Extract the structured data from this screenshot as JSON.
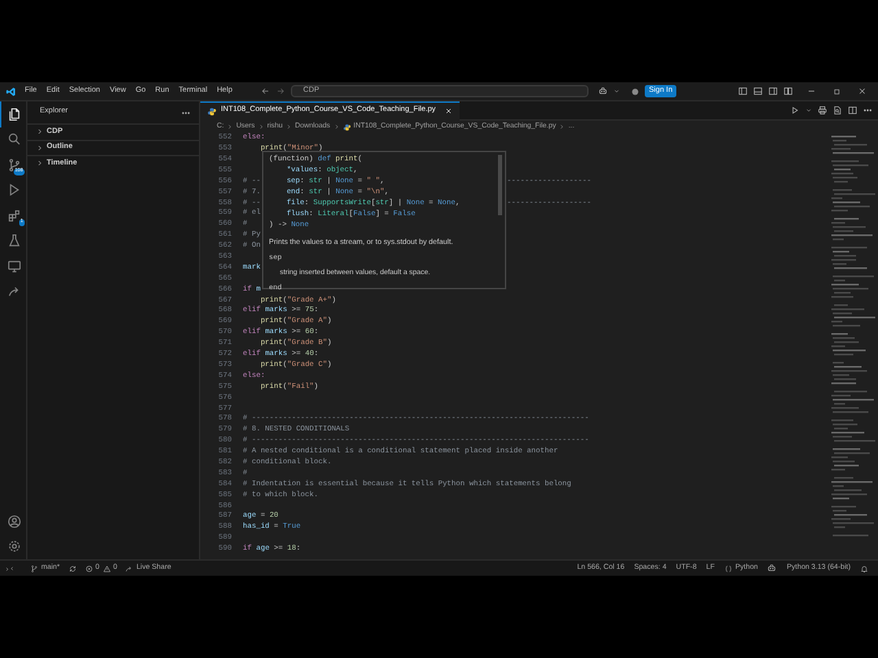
{
  "title_bar": {
    "menus": [
      "File",
      "Edit",
      "Selection",
      "View",
      "Go",
      "Run",
      "Terminal",
      "Help"
    ],
    "command_center": "CDP",
    "sign_in": "Sign In"
  },
  "activity_bar": {
    "items": [
      {
        "kind": "explorer",
        "selected": true
      },
      {
        "kind": "search",
        "selected": false
      },
      {
        "kind": "source-control",
        "selected": false,
        "badge": "108"
      },
      {
        "kind": "debug",
        "selected": false
      },
      {
        "kind": "extensions",
        "selected": false,
        "badge": "1"
      },
      {
        "kind": "testing",
        "selected": false
      },
      {
        "kind": "remote",
        "selected": false
      },
      {
        "kind": "liveshare",
        "selected": false
      }
    ]
  },
  "sidebar": {
    "title": "Explorer",
    "sections": [
      {
        "label": "CDP",
        "expanded": false
      },
      {
        "label": "Outline",
        "expanded": false
      },
      {
        "label": "Timeline",
        "expanded": false
      }
    ]
  },
  "tabs": [
    {
      "label": "INT108_Complete_Python_Course_VS_Code_Teaching_File.py",
      "selected": true
    }
  ],
  "breadcrumb": [
    {
      "kind": "folder",
      "text": "C:"
    },
    {
      "kind": "folder",
      "text": "Users"
    },
    {
      "kind": "folder",
      "text": "rishu"
    },
    {
      "kind": "folder",
      "text": "Downloads"
    },
    {
      "kind": "python",
      "text": "INT108_Complete_Python_Course_VS_Code_Teaching_File.py"
    },
    {
      "kind": "folder",
      "text": "..."
    }
  ],
  "editor": {
    "lines": [
      {
        "number": "552",
        "tokens": [
          {
            "kind": "kw",
            "text": "else:"
          }
        ]
      },
      {
        "number": "553",
        "tokens": [
          {
            "kind": "fn",
            "text": "    print"
          },
          {
            "kind": "pl",
            "text": "("
          },
          {
            "kind": "str",
            "text": "\"Minor\""
          },
          {
            "kind": "pl",
            "text": ")"
          }
        ]
      },
      {
        "number": "554"
      },
      {
        "number": "555"
      },
      {
        "number": "556",
        "tokens": [
          {
            "kind": "cm",
            "text": "# --"
          }
        ],
        "tail": "-------------------"
      },
      {
        "number": "557",
        "tokens": [
          {
            "kind": "cm",
            "text": "# 7."
          }
        ]
      },
      {
        "number": "558",
        "tokens": [
          {
            "kind": "cm",
            "text": "# --"
          }
        ],
        "tail": "-------------------"
      },
      {
        "number": "559",
        "tokens": [
          {
            "kind": "cm",
            "text": "# el"
          }
        ]
      },
      {
        "number": "560",
        "tokens": [
          {
            "kind": "cm",
            "text": "#"
          }
        ]
      },
      {
        "number": "561",
        "tokens": [
          {
            "kind": "cm",
            "text": "# Py"
          }
        ]
      },
      {
        "number": "562",
        "tokens": [
          {
            "kind": "cm",
            "text": "# On"
          }
        ]
      },
      {
        "number": "563"
      },
      {
        "number": "564",
        "tokens": [
          {
            "kind": "var",
            "text": "mark"
          }
        ]
      },
      {
        "number": "565"
      },
      {
        "number": "566",
        "tokens": [
          {
            "kind": "kw",
            "text": "if"
          },
          {
            "kind": "var",
            "text": " m"
          }
        ]
      },
      {
        "number": "567",
        "tokens": [
          {
            "kind": "fn",
            "text": "    print"
          },
          {
            "kind": "pl",
            "text": "("
          },
          {
            "kind": "str",
            "text": "\"Grade A+\""
          },
          {
            "kind": "pl",
            "text": ")"
          }
        ]
      },
      {
        "number": "568",
        "tokens": [
          {
            "kind": "kw",
            "text": "elif"
          },
          {
            "kind": "var",
            "text": " marks"
          },
          {
            "kind": "pl",
            "text": " >= "
          },
          {
            "kind": "num",
            "text": "75"
          },
          {
            "kind": "pl",
            "text": ":"
          }
        ]
      },
      {
        "number": "569",
        "tokens": [
          {
            "kind": "fn",
            "text": "    print"
          },
          {
            "kind": "pl",
            "text": "("
          },
          {
            "kind": "str",
            "text": "\"Grade A\""
          },
          {
            "kind": "pl",
            "text": ")"
          }
        ]
      },
      {
        "number": "570",
        "tokens": [
          {
            "kind": "kw",
            "text": "elif"
          },
          {
            "kind": "var",
            "text": " marks"
          },
          {
            "kind": "pl",
            "text": " >= "
          },
          {
            "kind": "num",
            "text": "60"
          },
          {
            "kind": "pl",
            "text": ":"
          }
        ]
      },
      {
        "number": "571",
        "tokens": [
          {
            "kind": "fn",
            "text": "    print"
          },
          {
            "kind": "pl",
            "text": "("
          },
          {
            "kind": "str",
            "text": "\"Grade B\""
          },
          {
            "kind": "pl",
            "text": ")"
          }
        ]
      },
      {
        "number": "572",
        "tokens": [
          {
            "kind": "kw",
            "text": "elif"
          },
          {
            "kind": "var",
            "text": " marks"
          },
          {
            "kind": "pl",
            "text": " >= "
          },
          {
            "kind": "num",
            "text": "40"
          },
          {
            "kind": "pl",
            "text": ":"
          }
        ]
      },
      {
        "number": "573",
        "tokens": [
          {
            "kind": "fn",
            "text": "    print"
          },
          {
            "kind": "pl",
            "text": "("
          },
          {
            "kind": "str",
            "text": "\"Grade C\""
          },
          {
            "kind": "pl",
            "text": ")"
          }
        ]
      },
      {
        "number": "574",
        "tokens": [
          {
            "kind": "kw",
            "text": "else:"
          }
        ]
      },
      {
        "number": "575",
        "tokens": [
          {
            "kind": "fn",
            "text": "    print"
          },
          {
            "kind": "pl",
            "text": "("
          },
          {
            "kind": "str",
            "text": "\"Fail\""
          },
          {
            "kind": "pl",
            "text": ")"
          }
        ]
      },
      {
        "number": "576"
      },
      {
        "number": "577"
      },
      {
        "number": "578",
        "tokens": [
          {
            "kind": "cm",
            "text": "# ----------------------------------------------------------------------------"
          }
        ]
      },
      {
        "number": "579",
        "tokens": [
          {
            "kind": "cm",
            "text": "# 8. NESTED CONDITIONALS"
          }
        ]
      },
      {
        "number": "580",
        "tokens": [
          {
            "kind": "cm",
            "text": "# ----------------------------------------------------------------------------"
          }
        ]
      },
      {
        "number": "581",
        "tokens": [
          {
            "kind": "cm",
            "text": "# A nested conditional is a conditional statement placed inside another"
          }
        ]
      },
      {
        "number": "582",
        "tokens": [
          {
            "kind": "cm",
            "text": "# conditional block."
          }
        ]
      },
      {
        "number": "583",
        "tokens": [
          {
            "kind": "cm",
            "text": "#"
          }
        ]
      },
      {
        "number": "584",
        "tokens": [
          {
            "kind": "cm",
            "text": "# Indentation is essential because it tells Python which statements belong"
          }
        ]
      },
      {
        "number": "585",
        "tokens": [
          {
            "kind": "cm",
            "text": "# to which block."
          }
        ]
      },
      {
        "number": "586"
      },
      {
        "number": "587",
        "tokens": [
          {
            "kind": "var",
            "text": "age"
          },
          {
            "kind": "pl",
            "text": " = "
          },
          {
            "kind": "num",
            "text": "20"
          }
        ]
      },
      {
        "number": "588",
        "tokens": [
          {
            "kind": "var",
            "text": "has_id"
          },
          {
            "kind": "pl",
            "text": " = "
          },
          {
            "kind": "const",
            "text": "True"
          }
        ]
      },
      {
        "number": "589"
      },
      {
        "number": "590",
        "tokens": [
          {
            "kind": "kw",
            "text": "if"
          },
          {
            "kind": "var",
            "text": " age"
          },
          {
            "kind": "pl",
            "text": " >= "
          },
          {
            "kind": "num",
            "text": "18"
          },
          {
            "kind": "pl",
            "text": ":"
          }
        ]
      }
    ]
  },
  "hover": {
    "signature": [
      [
        {
          "kind": "pl",
          "text": "(function) "
        },
        {
          "kind": "const",
          "text": "def"
        },
        {
          "kind": "fn",
          "text": " print"
        },
        {
          "kind": "pl",
          "text": "("
        }
      ],
      [
        {
          "kind": "var",
          "text": "    *values"
        },
        {
          "kind": "pl",
          "text": ": "
        },
        {
          "kind": "type",
          "text": "object"
        },
        {
          "kind": "pl",
          "text": ","
        }
      ],
      [
        {
          "kind": "var",
          "text": "    sep"
        },
        {
          "kind": "pl",
          "text": ": "
        },
        {
          "kind": "type",
          "text": "str"
        },
        {
          "kind": "pl",
          "text": " | "
        },
        {
          "kind": "const",
          "text": "None"
        },
        {
          "kind": "pl",
          "text": " = "
        },
        {
          "kind": "str",
          "text": "\" \""
        },
        {
          "kind": "pl",
          "text": ","
        }
      ],
      [
        {
          "kind": "var",
          "text": "    end"
        },
        {
          "kind": "pl",
          "text": ": "
        },
        {
          "kind": "type",
          "text": "str"
        },
        {
          "kind": "pl",
          "text": " | "
        },
        {
          "kind": "const",
          "text": "None"
        },
        {
          "kind": "pl",
          "text": " = "
        },
        {
          "kind": "str",
          "text": "\"\\n\""
        },
        {
          "kind": "pl",
          "text": ","
        }
      ],
      [
        {
          "kind": "var",
          "text": "    file"
        },
        {
          "kind": "pl",
          "text": ": "
        },
        {
          "kind": "type",
          "text": "SupportsWrite"
        },
        {
          "kind": "pl",
          "text": "["
        },
        {
          "kind": "type",
          "text": "str"
        },
        {
          "kind": "pl",
          "text": "] | "
        },
        {
          "kind": "const",
          "text": "None"
        },
        {
          "kind": "pl",
          "text": " = "
        },
        {
          "kind": "const",
          "text": "None"
        },
        {
          "kind": "pl",
          "text": ","
        }
      ],
      [
        {
          "kind": "var",
          "text": "    flush"
        },
        {
          "kind": "pl",
          "text": ": "
        },
        {
          "kind": "type",
          "text": "Literal"
        },
        {
          "kind": "pl",
          "text": "["
        },
        {
          "kind": "const",
          "text": "False"
        },
        {
          "kind": "pl",
          "text": "] = "
        },
        {
          "kind": "const",
          "text": "False"
        }
      ],
      [
        {
          "kind": "pl",
          "text": ") -> "
        },
        {
          "kind": "const",
          "text": "None"
        }
      ]
    ],
    "doc": "Prints the values to a stream, or to sys.stdout by default.",
    "params": [
      {
        "name": "sep",
        "description": "string inserted between values, default a space."
      },
      {
        "name": "end"
      }
    ]
  },
  "status_bar": {
    "left": [
      {
        "kind": "remote"
      },
      {
        "kind": "branch",
        "text": "main*"
      },
      {
        "kind": "sync"
      },
      {
        "kind": "problems",
        "errors": "0",
        "warnings": "0"
      },
      {
        "kind": "liveshare",
        "text": "Live Share"
      }
    ],
    "right": [
      {
        "kind": "text",
        "text": "Ln 566, Col 16"
      },
      {
        "kind": "text",
        "text": "Spaces: 4"
      },
      {
        "kind": "text",
        "text": "UTF-8"
      },
      {
        "kind": "text",
        "text": "LF"
      },
      {
        "kind": "language",
        "text": "Python"
      },
      {
        "kind": "copilot"
      },
      {
        "kind": "text",
        "text": "Python 3.13 (64-bit)"
      },
      {
        "kind": "bell"
      }
    ]
  }
}
